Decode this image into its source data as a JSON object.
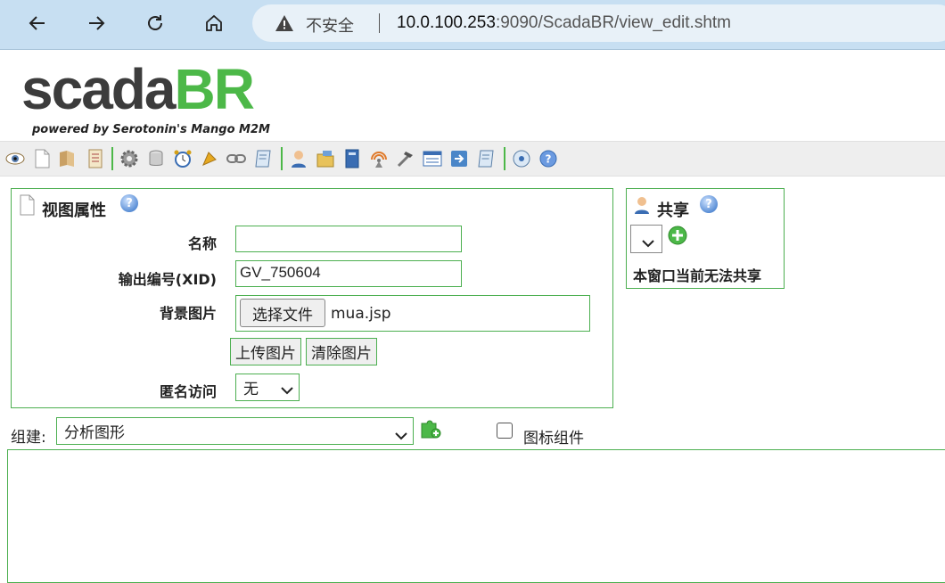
{
  "browser": {
    "insecure_label": "不安全",
    "url_host": "10.0.100.253",
    "url_rest": ":9090/ScadaBR/view_edit.shtm"
  },
  "logo": {
    "part1": "scada",
    "part2": "BR",
    "tagline": "powered by Serotonin's Mango M2M"
  },
  "toolbar": {
    "icons": [
      "eye-icon",
      "new-page-icon",
      "data-sources-icon",
      "watch-list-icon",
      "settings-gear-icon",
      "database-icon",
      "alarm-clock-icon",
      "event-handlers-icon",
      "link-icon",
      "scripts-icon",
      "users-icon",
      "folder-icon",
      "reports-icon",
      "publishers-icon",
      "tools-icon",
      "maintenance-icon",
      "import-export-icon",
      "sql-icon",
      "logout-icon",
      "help-icon"
    ]
  },
  "view_props": {
    "title": "视图属性",
    "name_label": "名称",
    "name_value": "",
    "xid_label": "输出编号(XID)",
    "xid_value": "GV_750604",
    "bg_label": "背景图片",
    "choose_file": "选择文件",
    "file_name": "mua.jsp",
    "upload_btn": "上传图片",
    "clear_btn": "清除图片",
    "anon_label": "匿名访问",
    "anon_value": "无"
  },
  "share": {
    "title": "共享",
    "status": "本窗口当前无法共享"
  },
  "component": {
    "label": "组建:",
    "select_value": "分析图形",
    "icon_checkbox_label": "图标组件"
  }
}
